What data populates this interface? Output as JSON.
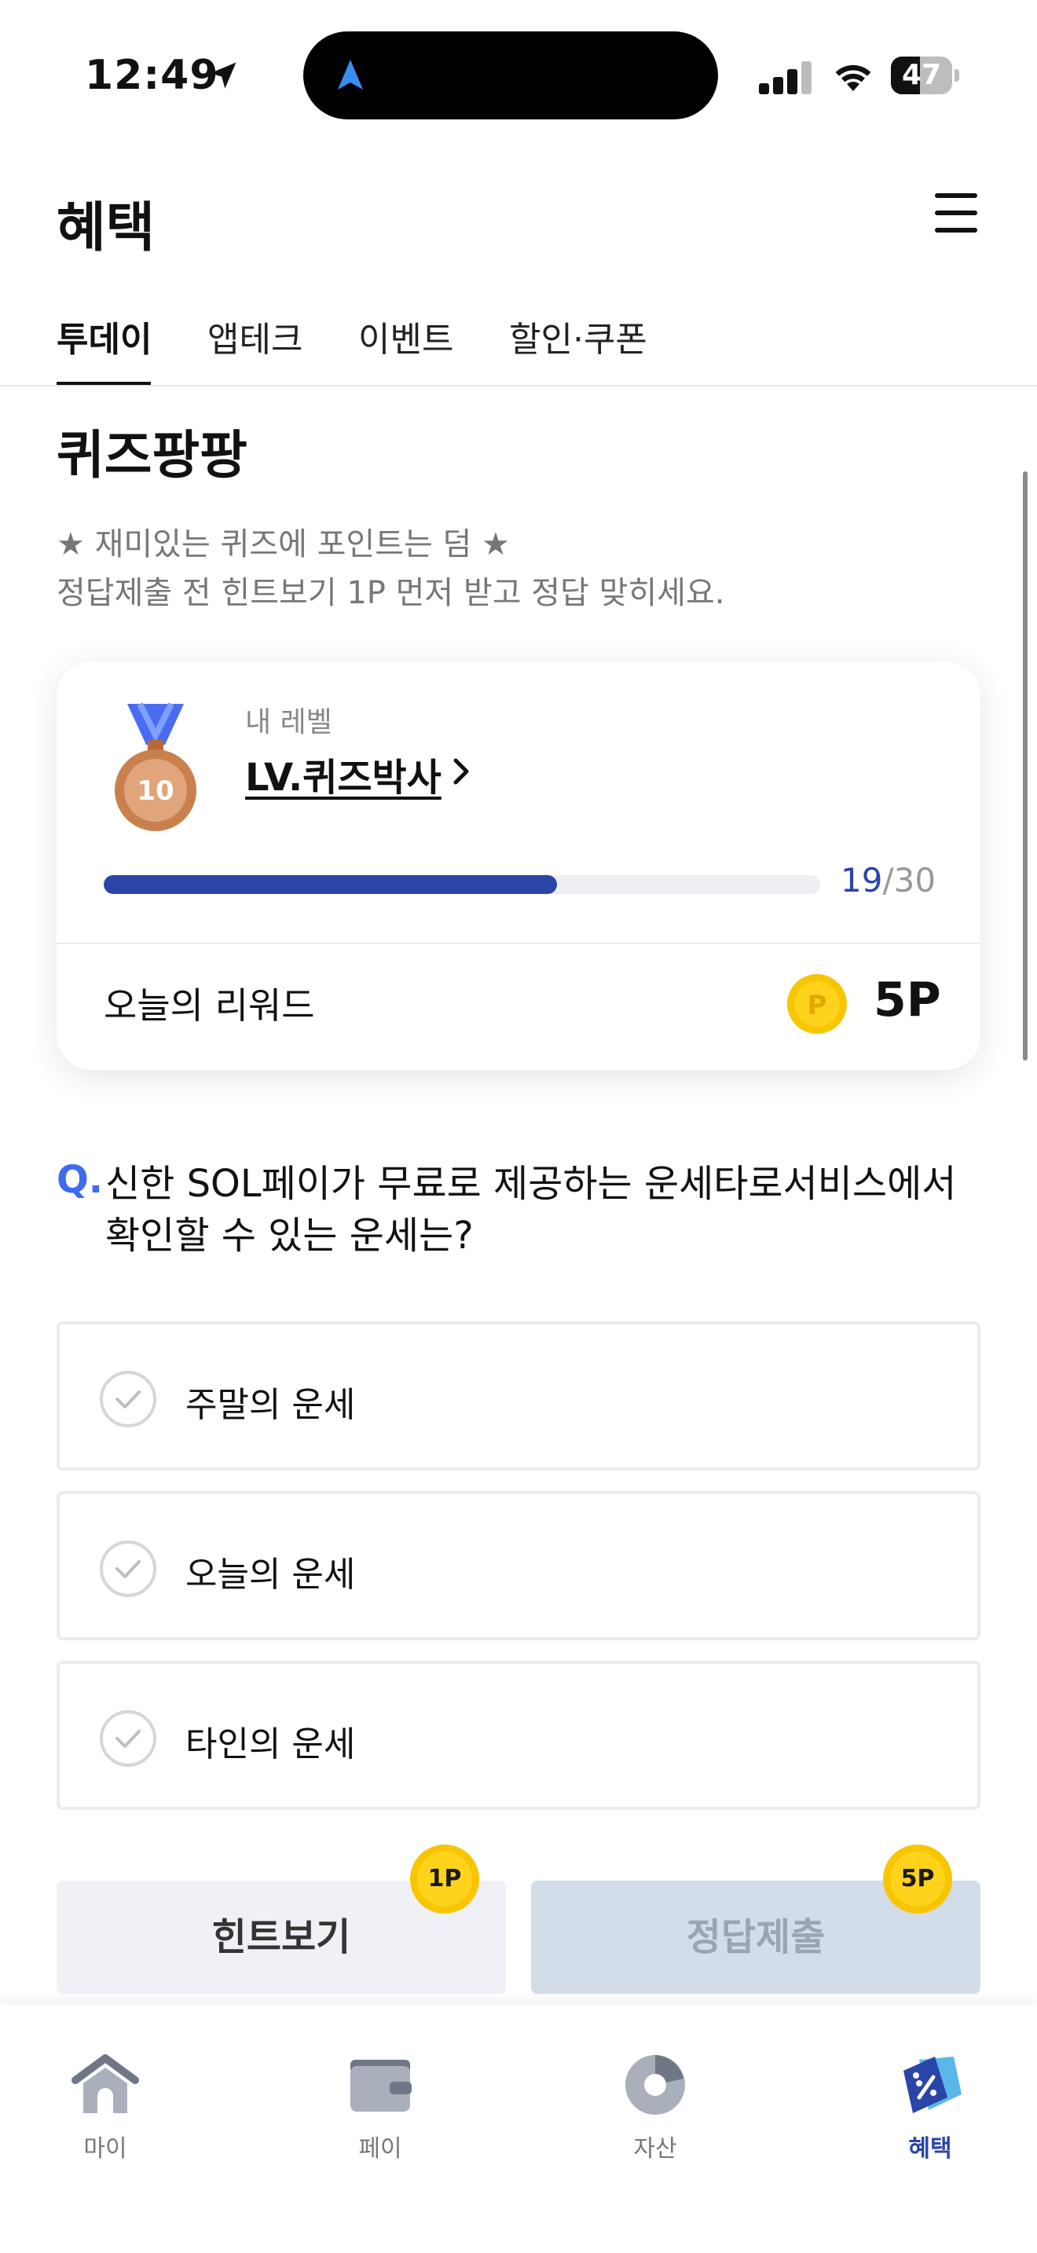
{
  "status_bar": {
    "time": "12:49",
    "battery": "47",
    "battery_level": 0.47
  },
  "header": {
    "title": "혜택"
  },
  "tabs": [
    {
      "label": "투데이",
      "active": true
    },
    {
      "label": "앱테크",
      "active": false
    },
    {
      "label": "이벤트",
      "active": false
    },
    {
      "label": "할인·쿠폰",
      "active": false
    }
  ],
  "quiz": {
    "title": "퀴즈팡팡",
    "desc_line1": "★ 재미있는 퀴즈에 포인트는 덤 ★",
    "desc_line2": "정답제출 전 힌트보기 1P 먼저 받고 정답 맞히세요."
  },
  "level_card": {
    "medal_number": "10",
    "caption": "내 레벨",
    "level_name": "LV.퀴즈박사",
    "progress_current": "19",
    "progress_total": "/30",
    "progress_fraction": 0.633,
    "reward_label": "오늘의 리워드",
    "reward_value": "5P",
    "coin_symbol": "P"
  },
  "question": {
    "marker": "Q.",
    "text": "신한 SOL페이가 무료로 제공하는 운세타로서비스에서 확인할 수 있는 운세는?",
    "options": [
      {
        "label": "주말의 운세"
      },
      {
        "label": "오늘의 운세"
      },
      {
        "label": "타인의 운세"
      }
    ]
  },
  "actions": {
    "hint_label": "힌트보기",
    "hint_badge": "1P",
    "submit_label": "정답제출",
    "submit_badge": "5P"
  },
  "tabbar": [
    {
      "label": "마이",
      "icon": "home-icon",
      "active": false
    },
    {
      "label": "페이",
      "icon": "wallet-icon",
      "active": false
    },
    {
      "label": "자산",
      "icon": "pie-chart-icon",
      "active": false
    },
    {
      "label": "혜택",
      "icon": "benefit-tag-icon",
      "active": true
    }
  ],
  "colors": {
    "accent": "#2a45a8",
    "question_marker": "#3b6cf0",
    "coin": "#f7c600"
  }
}
